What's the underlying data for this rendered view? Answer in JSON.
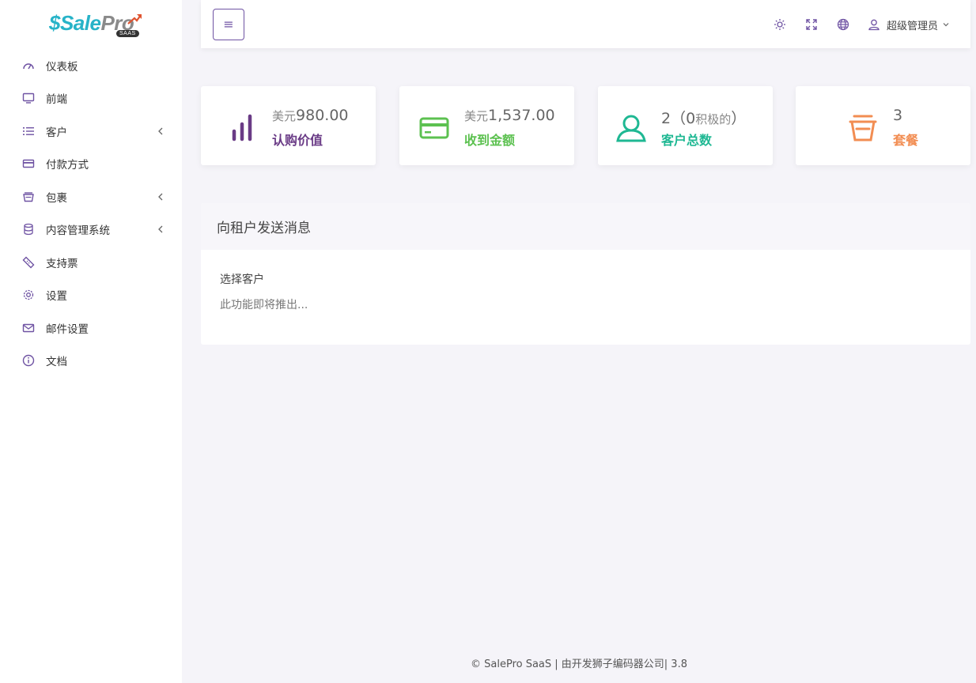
{
  "logo": {
    "sale": "Sale",
    "pro": "Pro",
    "dollar": "$",
    "badge": "SAAS"
  },
  "sidebar": {
    "items": [
      {
        "label": "仪表板",
        "icon": "dashboard-gauge-icon",
        "has_children": false
      },
      {
        "label": "前端",
        "icon": "monitor-icon",
        "has_children": false
      },
      {
        "label": "客户",
        "icon": "list-icon",
        "has_children": true
      },
      {
        "label": "付款方式",
        "icon": "credit-card-icon",
        "has_children": false
      },
      {
        "label": "包裹",
        "icon": "basket-icon",
        "has_children": true
      },
      {
        "label": "内容管理系统",
        "icon": "database-icon",
        "has_children": true
      },
      {
        "label": "支持票",
        "icon": "ticket-icon",
        "has_children": false
      },
      {
        "label": "设置",
        "icon": "gear-icon",
        "has_children": false
      },
      {
        "label": "邮件设置",
        "icon": "mail-icon",
        "has_children": false
      },
      {
        "label": "文档",
        "icon": "info-icon",
        "has_children": false
      }
    ]
  },
  "topbar": {
    "menu_button": "≡",
    "user_name": "超级管理员"
  },
  "cards": [
    {
      "prefix": "美元",
      "value": "980.00",
      "label": "认购价值",
      "color": "#6a3b86",
      "icon": "bar-chart-icon"
    },
    {
      "prefix": "美元",
      "value": "1,537.00",
      "label": "收到金额",
      "color": "#5cc150",
      "icon": "credit-card-icon"
    },
    {
      "value": "2（0",
      "suffix": "积极的",
      "close": "）",
      "label": "客户总数",
      "color": "#1fb893",
      "icon": "user-icon"
    },
    {
      "value": "3",
      "label": "套餐",
      "color": "#f28d52",
      "icon": "basket-icon"
    }
  ],
  "message_panel": {
    "title": "向租户发送消息",
    "field_label": "选择客户",
    "note": "此功能即将推出..."
  },
  "footer": {
    "text": "© SalePro SaaS | 由开发狮子编码器公司| 3.8"
  }
}
